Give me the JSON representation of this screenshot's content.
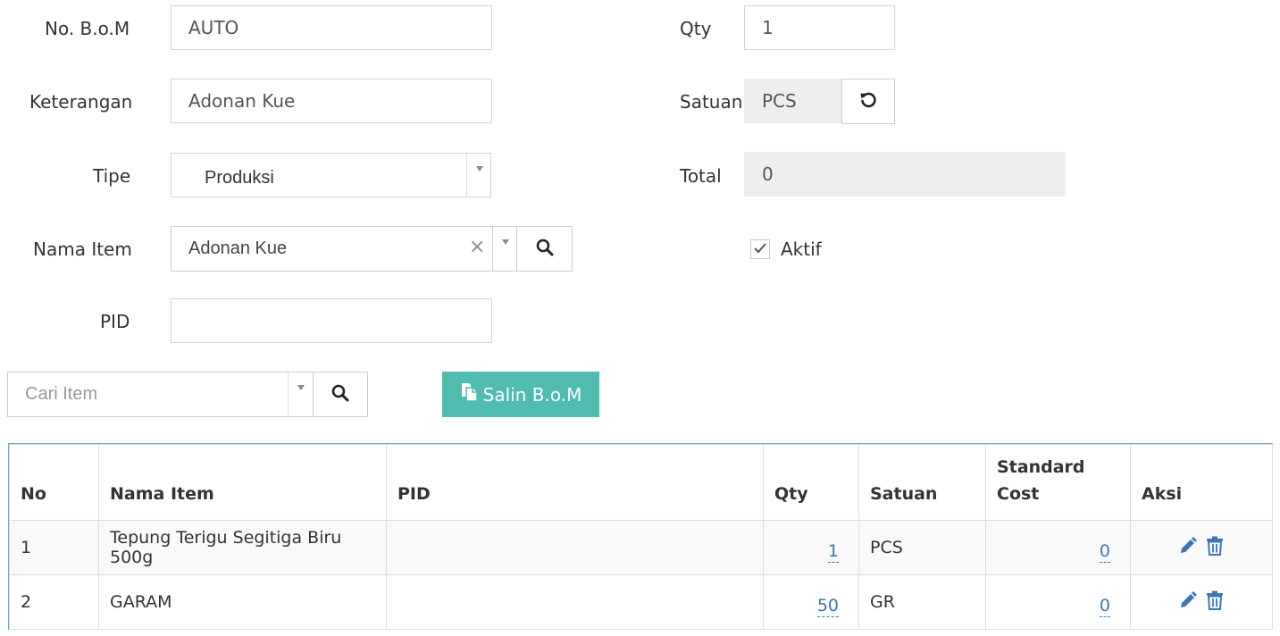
{
  "form": {
    "bom_label": "No. B.o.M",
    "bom_value": "AUTO",
    "keterangan_label": "Keterangan",
    "keterangan_value": "Adonan Kue",
    "tipe_label": "Tipe",
    "tipe_value": "Produksi",
    "nama_item_label": "Nama Item",
    "nama_item_value": "Adonan Kue",
    "clear_symbol": "×",
    "pid_label": "PID",
    "pid_value": "",
    "qty_label": "Qty",
    "qty_value": "1",
    "satuan_label": "Satuan",
    "satuan_value": "PCS",
    "total_label": "Total",
    "total_value": "0",
    "aktif_label": "Aktif",
    "aktif_checked": true
  },
  "toolbar": {
    "cari_item_placeholder": "Cari Item",
    "salin_label": "Salin B.o.M"
  },
  "table": {
    "headers": {
      "no": "No",
      "nama_item": "Nama Item",
      "pid": "PID",
      "qty": "Qty",
      "satuan": "Satuan",
      "standard_cost": "Standard Cost",
      "aksi": "Aksi"
    },
    "rows": [
      {
        "no": "1",
        "nama_item": "Tepung Terigu Segitiga Biru 500g",
        "pid": "",
        "qty": "1",
        "satuan": "PCS",
        "standard_cost": "0"
      },
      {
        "no": "2",
        "nama_item": "GARAM",
        "pid": "",
        "qty": "50",
        "satuan": "GR",
        "standard_cost": "0"
      }
    ]
  },
  "colors": {
    "accent": "#4fbcae",
    "link": "#3a78b4",
    "readonly_bg": "#eeeeee"
  },
  "icons": {
    "search": "search-icon",
    "refresh": "refresh-icon",
    "copy": "copy-icon",
    "edit": "pencil-icon",
    "delete": "trash-icon",
    "check": "check-icon"
  }
}
